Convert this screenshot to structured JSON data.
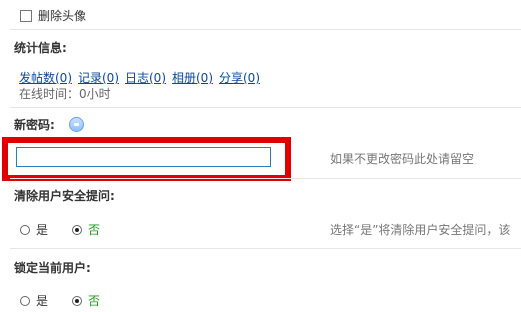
{
  "delete_avatar": {
    "label": "删除头像"
  },
  "stats": {
    "title": "统计信息:",
    "links": [
      "发帖数(0)",
      "记录(0)",
      "日志(0)",
      "相册(0)",
      "分享(0)"
    ],
    "online_time": "在线时间：0小时"
  },
  "new_password": {
    "title": "新密码:",
    "value": "",
    "hint": "如果不更改密码此处请留空"
  },
  "clear_security_question": {
    "title": "清除用户安全提问:",
    "options": [
      "是",
      "否"
    ],
    "selected": "否",
    "hint": "选择“是”将清除用户安全提问，该"
  },
  "lock_user": {
    "title": "锁定当前用户:",
    "options": [
      "是",
      "否"
    ],
    "selected": "否"
  },
  "colors": {
    "link": "#0b4aa2",
    "highlight": "#e00000",
    "no_option": "#1a9e1a"
  },
  "icons": [
    "help-icon"
  ]
}
